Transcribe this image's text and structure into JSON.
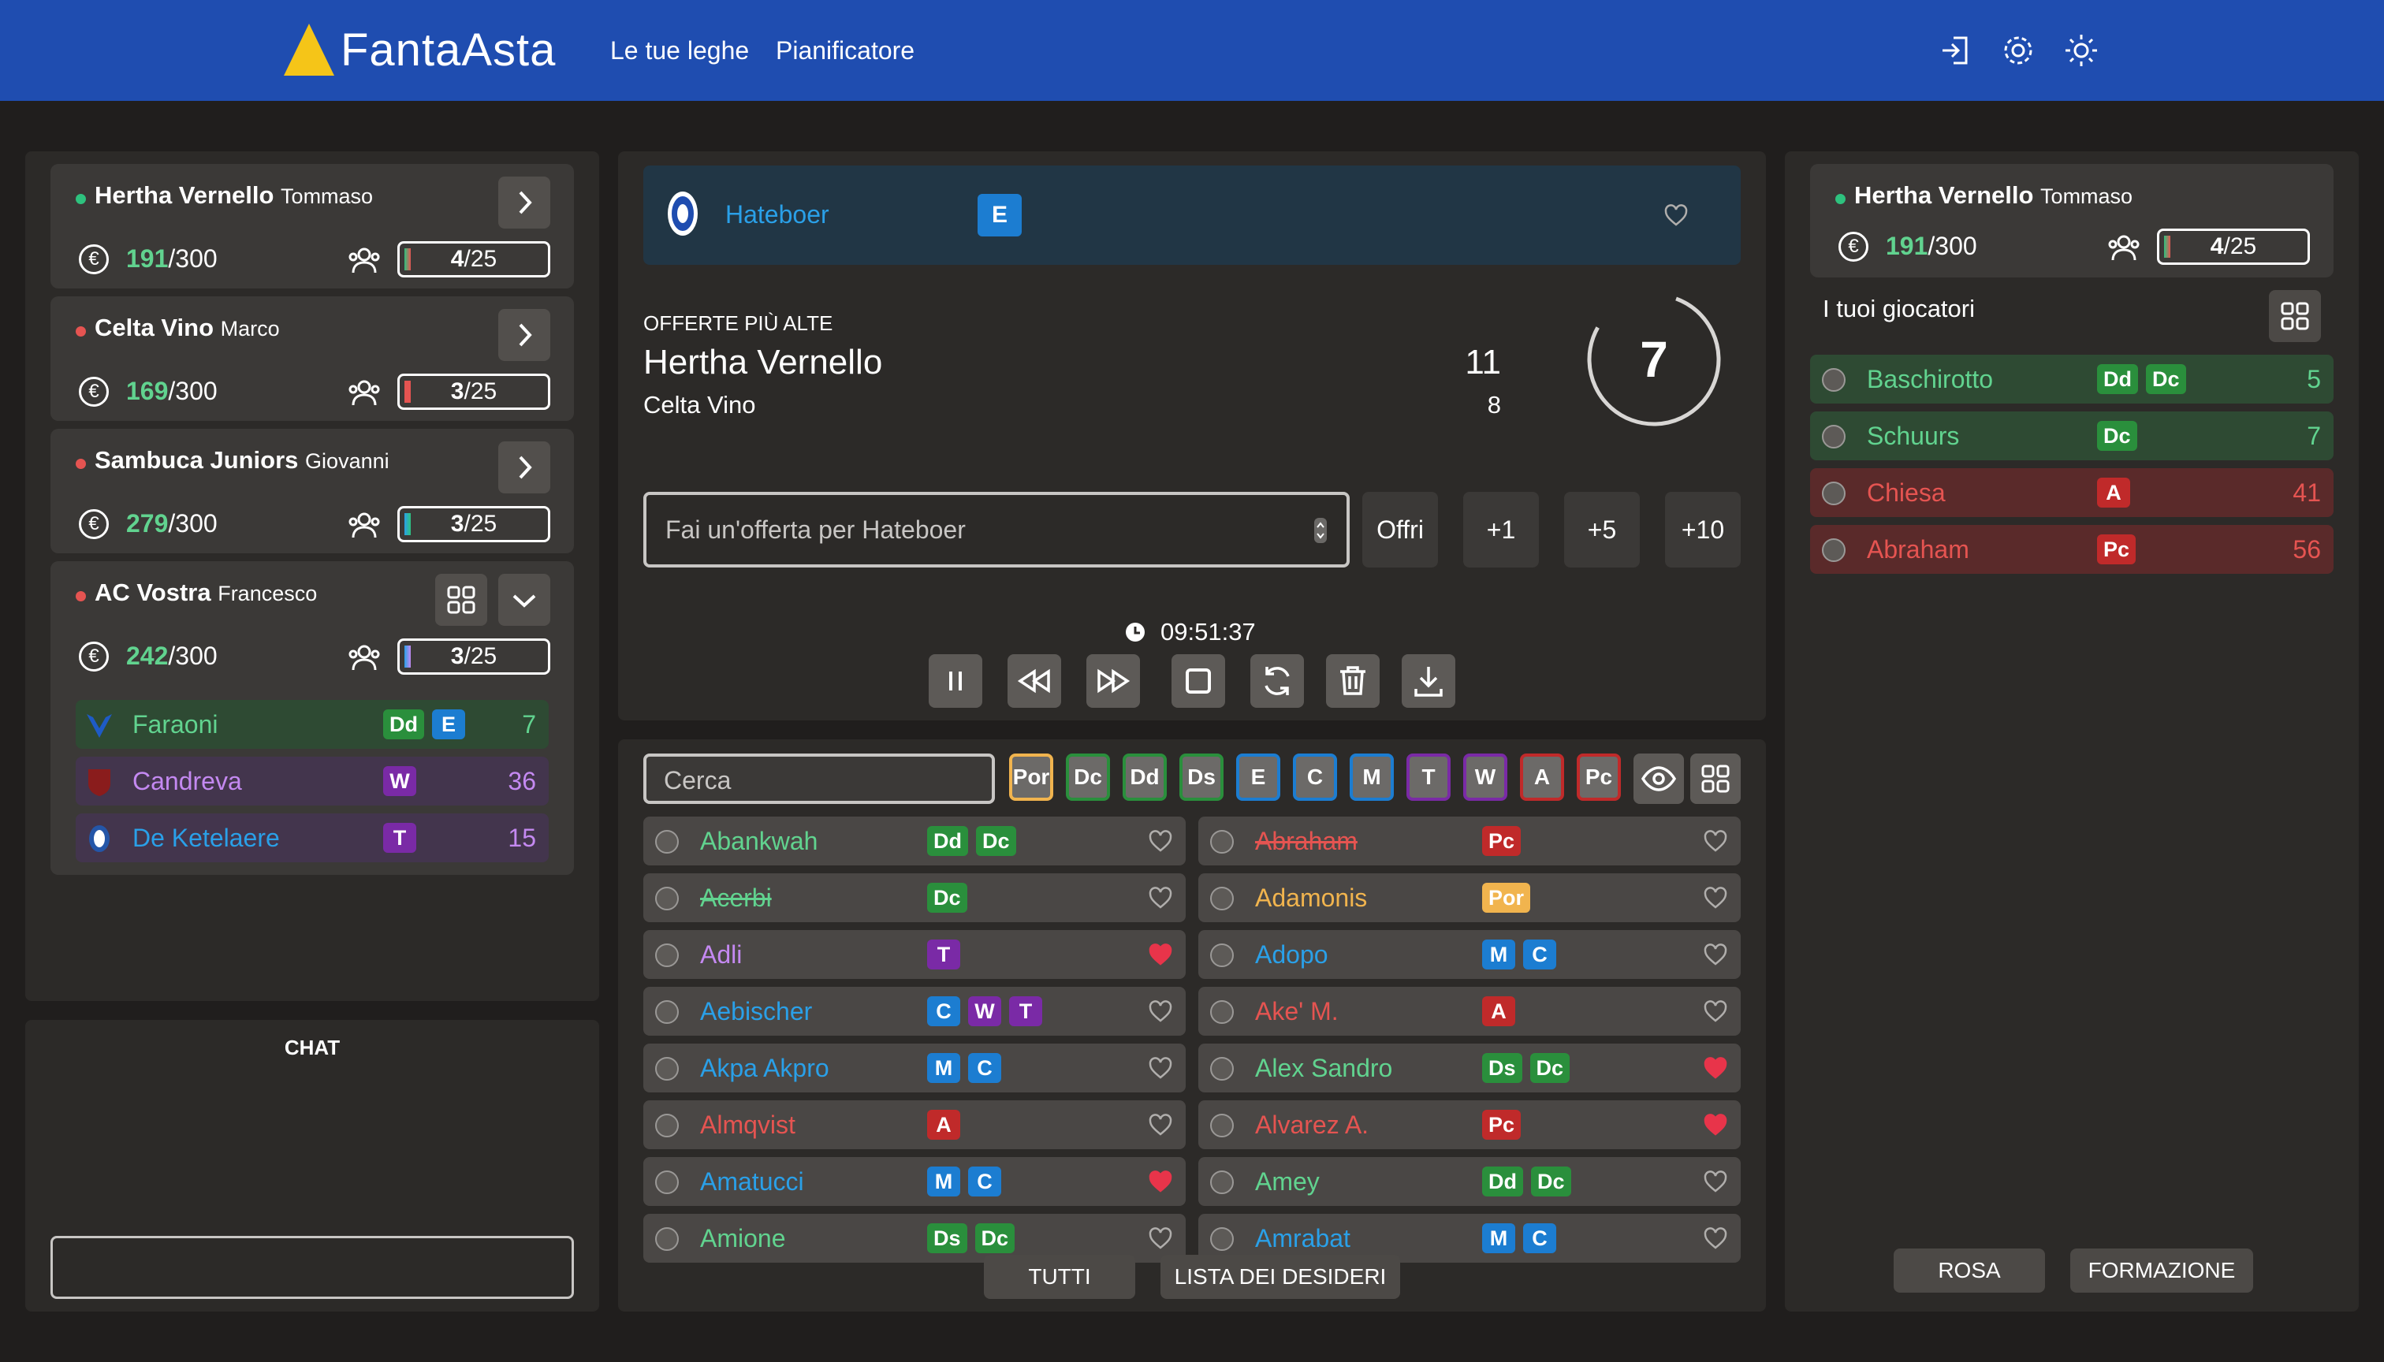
{
  "colors": {
    "green": "#61d38f",
    "red": "#e55451",
    "blue": "#2aa0e8",
    "purple": "#c489f1",
    "orange": "#f1b44e"
  },
  "header": {
    "brand": "FantaAsta",
    "nav": [
      "Le tue leghe",
      "Pianificatore"
    ],
    "icons": [
      "logout-icon",
      "settings-icon",
      "theme-icon"
    ]
  },
  "teams": [
    {
      "name": "Hertha Vernello",
      "owner": "Tommaso",
      "status": "online",
      "credits": "191",
      "total": "/300",
      "slots": "4",
      "slots_total": "/25"
    },
    {
      "name": "Celta Vino",
      "owner": "Marco",
      "status": "offline",
      "credits": "169",
      "total": "/300",
      "slots": "3",
      "slots_total": "/25"
    },
    {
      "name": "Sambuca Juniors",
      "owner": "Giovanni",
      "status": "offline",
      "credits": "279",
      "total": "/300",
      "slots": "3",
      "slots_total": "/25"
    },
    {
      "name": "AC Vostra",
      "owner": "Francesco",
      "status": "offline",
      "credits": "242",
      "total": "/300",
      "slots": "3",
      "slots_total": "/25",
      "players": [
        {
          "name": "Faraoni",
          "roles": [
            "Dd",
            "E"
          ],
          "price": "7",
          "color": "green"
        },
        {
          "name": "Candreva",
          "roles": [
            "W"
          ],
          "price": "36",
          "color": "purple"
        },
        {
          "name": "De Ketelaere",
          "roles": [
            "T"
          ],
          "price": "15",
          "color": "blue"
        }
      ]
    }
  ],
  "chat": {
    "title": "CHAT",
    "input_value": ""
  },
  "auction": {
    "player": "Hateboer",
    "role": "E",
    "offers_title": "OFFERTE PIÙ ALTE",
    "offers": [
      {
        "team": "Hertha Vernello",
        "value": "11"
      },
      {
        "team": "Celta Vino",
        "value": "8"
      }
    ],
    "countdown": "7",
    "bid_placeholder": "Fai un'offerta per Hateboer",
    "offer_btn": "Offri",
    "inc": [
      "+1",
      "+5",
      "+10"
    ],
    "clock": "09:51:37"
  },
  "search": {
    "placeholder": "Cerca",
    "filters": [
      "Por",
      "Dc",
      "Dd",
      "Ds",
      "E",
      "C",
      "M",
      "T",
      "W",
      "A",
      "Pc"
    ]
  },
  "players_left": [
    {
      "name": "Abankwah",
      "roles": [
        "Dd",
        "Dc"
      ],
      "color": "green",
      "fav": false,
      "strike": false
    },
    {
      "name": "Acerbi",
      "roles": [
        "Dc"
      ],
      "color": "green",
      "fav": false,
      "strike": true
    },
    {
      "name": "Adli",
      "roles": [
        "T"
      ],
      "color": "purple",
      "fav": true,
      "strike": false
    },
    {
      "name": "Aebischer",
      "roles": [
        "C",
        "W",
        "T"
      ],
      "color": "blue",
      "fav": false,
      "strike": false
    },
    {
      "name": "Akpa Akpro",
      "roles": [
        "M",
        "C"
      ],
      "color": "blue",
      "fav": false,
      "strike": false
    },
    {
      "name": "Almqvist",
      "roles": [
        "A"
      ],
      "color": "red",
      "fav": false,
      "strike": false
    },
    {
      "name": "Amatucci",
      "roles": [
        "M",
        "C"
      ],
      "color": "blue",
      "fav": true,
      "strike": false
    },
    {
      "name": "Amione",
      "roles": [
        "Ds",
        "Dc"
      ],
      "color": "green",
      "fav": false,
      "strike": false
    }
  ],
  "players_right": [
    {
      "name": "Abraham",
      "roles": [
        "Pc"
      ],
      "color": "red",
      "fav": false,
      "strike": true
    },
    {
      "name": "Adamonis",
      "roles": [
        "Por"
      ],
      "color": "orange",
      "fav": false,
      "strike": false
    },
    {
      "name": "Adopo",
      "roles": [
        "M",
        "C"
      ],
      "color": "blue",
      "fav": false,
      "strike": false
    },
    {
      "name": "Ake' M.",
      "roles": [
        "A"
      ],
      "color": "red",
      "fav": false,
      "strike": false
    },
    {
      "name": "Alex Sandro",
      "roles": [
        "Ds",
        "Dc"
      ],
      "color": "green",
      "fav": true,
      "strike": false
    },
    {
      "name": "Alvarez A.",
      "roles": [
        "Pc"
      ],
      "color": "red",
      "fav": true,
      "strike": false
    },
    {
      "name": "Amey",
      "roles": [
        "Dd",
        "Dc"
      ],
      "color": "green",
      "fav": false,
      "strike": false
    },
    {
      "name": "Amrabat",
      "roles": [
        "M",
        "C"
      ],
      "color": "blue",
      "fav": false,
      "strike": false
    }
  ],
  "list_tabs": [
    "TUTTI",
    "LISTA DEI DESIDERI"
  ],
  "my_team": {
    "name": "Hertha Vernello",
    "owner": "Tommaso",
    "credits": "191",
    "total": "/300",
    "slots": "4",
    "slots_total": "/25",
    "title": "I tuoi giocatori",
    "players": [
      {
        "name": "Baschirotto",
        "roles": [
          "Dd",
          "Dc"
        ],
        "price": "5",
        "color": "green"
      },
      {
        "name": "Schuurs",
        "roles": [
          "Dc"
        ],
        "price": "7",
        "color": "green"
      },
      {
        "name": "Chiesa",
        "roles": [
          "A"
        ],
        "price": "41",
        "color": "red"
      },
      {
        "name": "Abraham",
        "roles": [
          "Pc"
        ],
        "price": "56",
        "color": "red"
      }
    ],
    "tabs": [
      "ROSA",
      "FORMAZIONE"
    ]
  }
}
